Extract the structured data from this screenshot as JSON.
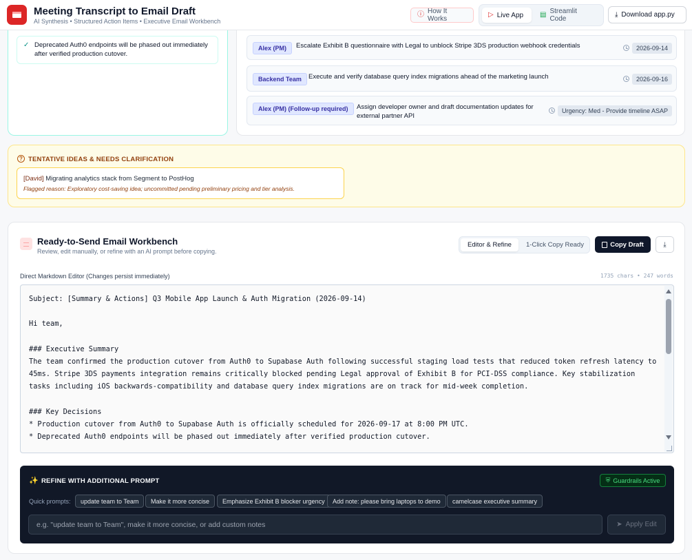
{
  "header": {
    "title": "Meeting Transcript to Email Draft",
    "subtitle": "AI Synthesis • Structured Action Items • Executive Email Workbench",
    "how_label": "How It Works",
    "live_label": "Live App",
    "code_label": "Streamlit Code",
    "download_label": "Download app.py"
  },
  "decisions": {
    "items": [
      {
        "text": "Deprecated Auth0 endpoints will be phased out immediately after verified production cutover."
      }
    ]
  },
  "actions": {
    "items": [
      {
        "owner": "Alex (PM)",
        "task": "Escalate Exhibit B questionnaire with Legal to unblock Stripe 3DS production webhook credentials",
        "due": "2026-09-14"
      },
      {
        "owner": "Backend Team",
        "task": "Execute and verify database query index migrations ahead of the marketing launch",
        "due": "2026-09-16"
      },
      {
        "owner": "Alex (PM) (Follow-up required)",
        "task": "Assign developer owner and draft documentation updates for external partner API",
        "due": "Urgency: Med - Provide timeline ASAP"
      }
    ]
  },
  "tentative": {
    "title": "TENTATIVE IDEAS & NEEDS CLARIFICATION",
    "items": [
      {
        "who": "[David]",
        "text": "Migrating analytics stack from Segment to PostHog",
        "reason": "Flagged reason: Exploratory cost-saving idea; uncommitted pending preliminary pricing and tier analysis."
      }
    ]
  },
  "workbench": {
    "title": "Ready-to-Send Email Workbench",
    "subtitle": "Review, edit manually, or refine with an AI prompt before copying.",
    "tab_edit": "Editor & Refine",
    "tab_ready": "1-Click Copy Ready",
    "copy_label": "Copy Draft",
    "editor_label": "Direct Markdown Editor (Changes persist immediately)",
    "counts": "1735 chars • 247 words",
    "editor_text": "Subject: [Summary & Actions] Q3 Mobile App Launch & Auth Migration (2026-09-14)\n\nHi team,\n\n### Executive Summary\nThe team confirmed the production cutover from Auth0 to Supabase Auth following successful staging load tests that reduced token refresh latency to 45ms. Stripe 3DS payments integration remains critically blocked pending Legal approval of Exhibit B for PCI-DSS compliance. Key stabilization tasks including iOS backwards-compatibility and database query index migrations are on track for mid-week completion.\n\n### Key Decisions\n* Production cutover from Auth0 to Supabase Auth is officially scheduled for 2026-09-17 at 8:00 PM UTC.\n* Deprecated Auth0 endpoints will be phased out immediately after verified production cutover."
  },
  "refine": {
    "title": "REFINE WITH ADDITIONAL PROMPT",
    "guardrails": "Guardrails Active",
    "quick_label": "Quick prompts:",
    "chips": [
      "update team to Team",
      "Make it more concise",
      "Emphasize Exhibit B blocker urgency",
      "Add note: please bring laptops to demo",
      "camelcase executive summary"
    ],
    "placeholder": "e.g. \"update team to Team\", make it more concise, or add custom notes",
    "apply_label": "Apply Edit"
  }
}
